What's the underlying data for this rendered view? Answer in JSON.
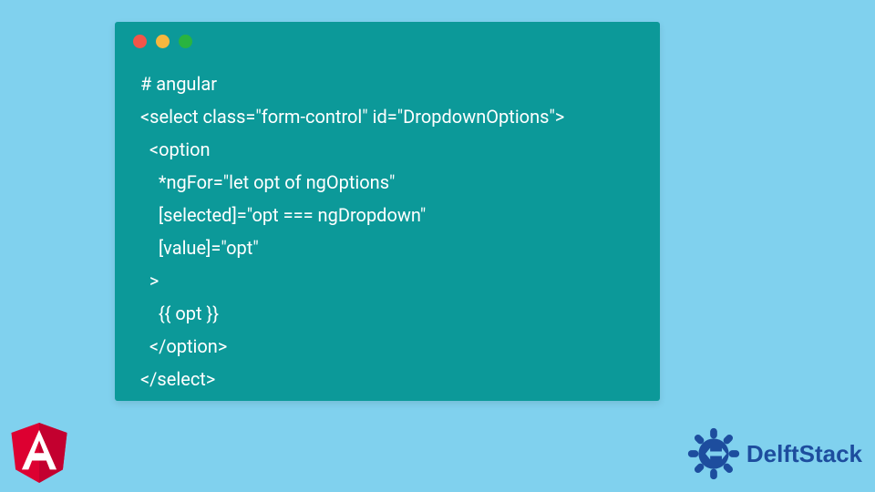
{
  "code_block": {
    "lines": [
      "# angular",
      "<select class=\"form-control\" id=\"DropdownOptions\">",
      "  <option",
      "    *ngFor=\"let opt of ngOptions\"",
      "    [selected]=\"opt === ngDropdown\"",
      "    [value]=\"opt\"",
      "  >",
      "    {{ opt }}",
      "  </option>",
      "</select>"
    ],
    "window_colors": {
      "red": "#f35549",
      "yellow": "#f6b73e",
      "green": "#29b440"
    },
    "bg": "#0c9999",
    "fg": "#ffffff"
  },
  "page_bg": "#80d1ee",
  "logos": {
    "angular_letter": "A",
    "angular_color": "#dd0031",
    "delftstack_text": "DelftStack",
    "delftstack_color": "#1d4d9e"
  }
}
